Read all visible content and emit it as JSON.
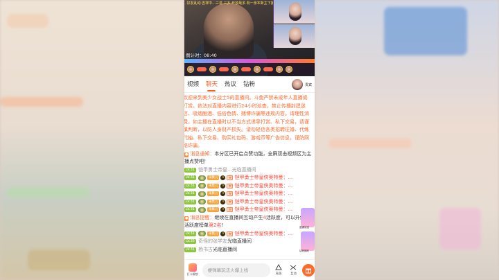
{
  "video": {
    "banner": "·好友乱动·吉祥中...三进·三多·开放最多·有一亲本新主下播不是新生之中 一·方面·十分专业",
    "timer": "倒计时：08:40",
    "thumbs": [
      "",
      ""
    ]
  },
  "tabs": [
    {
      "label": "视频",
      "active": false
    },
    {
      "label": "聊天",
      "active": true
    },
    {
      "label": "热议",
      "active": false
    },
    {
      "label": "钻粉",
      "active": false
    }
  ],
  "anchor": {
    "name": "贵宾"
  },
  "chat": {
    "welcome": "欢迎来到美少女战士5的直播间。斗鱼严禁未成年人直播或打赏。依法对直播内容进行24小时巡查，禁止传播封建迷信、吸烟酗酒、低俗色情、赌博诈骗等违规内容。请理性消费，如主播在直播时以不当方式诱导打赏、私下交易，请谨慎判断，以防人身财产损失。请勿轻信各类招聘征婚、代练代抽、私下交易、购买礼包码、游戏币等广告信息，谨防网络诈骗。",
    "notice1_title": "消息通知：",
    "notice1_body": "本分区已开启点赞功能，全屏双击视频区为主播点赞吧！",
    "enter1_level": "LV.31",
    "enter1_text": "铠甲勇士帝皇...光临直播间",
    "gift_level": "LV.31",
    "gift_fan": "采集儿",
    "gift_v": "V",
    "gift_n": "吴",
    "gift_text": "铠甲勇士帝皇侠奥特曼：...",
    "gift_rows_count_label": "",
    "notice2_title": "消息提醒：",
    "notice2_body_a": "继续在直播间互动产生",
    "notice2_num": "4",
    "notice2_body_b": "活跃度，可以升级到周活跃度榜单",
    "notice2_rank": "第2名",
    "notice2_end": "!",
    "enter2_level": "LV.35",
    "enter2_name": "奇怪的张学友",
    "enter2_text": "光临直播间",
    "enter3_level": "LV.31",
    "enter3_name": "杨书古",
    "enter3_text": "光临直播间"
  },
  "side_ads": [
    {
      "label": "直通读宝"
    },
    {
      "label": "钻粉福利"
    }
  ],
  "bottombar": {
    "left_label": "打卡解锁",
    "input_placeholder": "梗弹幕玩法火爆上线",
    "charge_label": "充值",
    "interact_label": "互动"
  },
  "colors": {
    "accent": "#ff5d23",
    "notice": "#ff6a2b",
    "level": "#8cc63f"
  }
}
